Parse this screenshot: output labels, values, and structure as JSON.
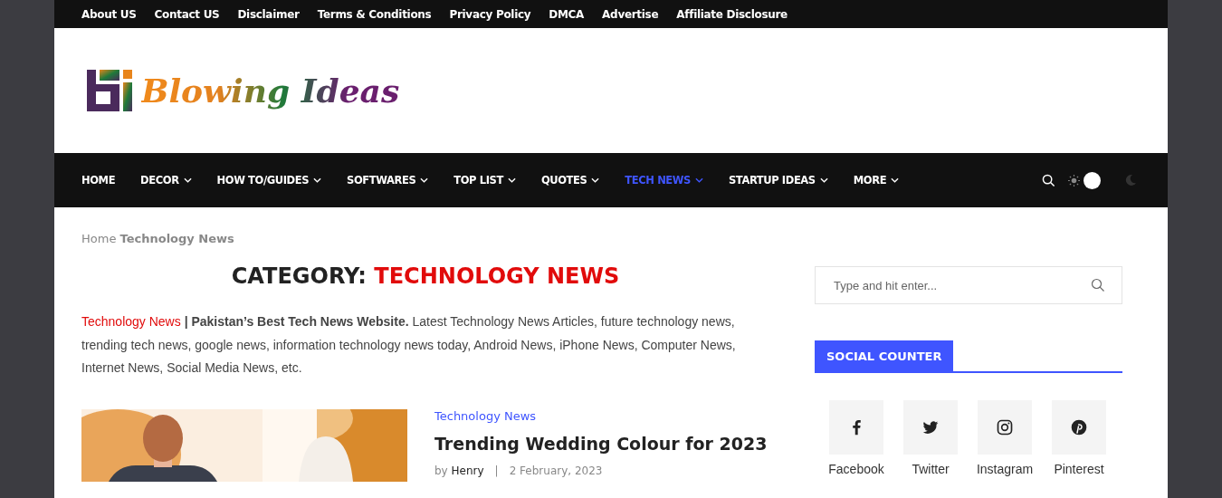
{
  "top_links": [
    "About US",
    "Contact US",
    "Disclaimer",
    "Terms & Conditions",
    "Privacy Policy",
    "DMCA",
    "Advertise",
    "Affiliate Disclosure"
  ],
  "logo": {
    "text": "Blowing Ideas"
  },
  "nav": [
    {
      "label": "HOME",
      "has_menu": false,
      "selected": false
    },
    {
      "label": "DECOR",
      "has_menu": true,
      "selected": false
    },
    {
      "label": "HOW TO/GUIDES",
      "has_menu": true,
      "selected": false
    },
    {
      "label": "SOFTWARES",
      "has_menu": true,
      "selected": false
    },
    {
      "label": "TOP LIST",
      "has_menu": true,
      "selected": false
    },
    {
      "label": "QUOTES",
      "has_menu": true,
      "selected": false
    },
    {
      "label": "TECH NEWS",
      "has_menu": true,
      "selected": true
    },
    {
      "label": "STARTUP IDEAS",
      "has_menu": true,
      "selected": false
    },
    {
      "label": "MORE",
      "has_menu": true,
      "selected": false
    }
  ],
  "dark_mode": false,
  "breadcrumb": {
    "home": "Home",
    "current": "Technology News"
  },
  "heading": {
    "prefix": "CATEGORY:",
    "name": "TECHNOLOGY NEWS"
  },
  "description": {
    "link": "Technology News",
    "text": "**| Pakistan’s Best Tech News Website.** Latest Technology News Articles, future technology news, trending tech news, google news, information technology news today, Android News, iPhone News, Computer News, Internet News, Social Media News, etc."
  },
  "article": {
    "category": "Technology News",
    "title": "Trending Wedding Colour for 2023",
    "by": "by",
    "author": "Henry",
    "separator": "|",
    "date": "2 February, 2023"
  },
  "search": {
    "placeholder": "Type and hit enter..."
  },
  "social_counter": {
    "title": "SOCIAL COUNTER",
    "items": [
      {
        "kind": "facebook",
        "label": "Facebook"
      },
      {
        "kind": "twitter",
        "label": "Twitter"
      },
      {
        "kind": "instagram",
        "label": "Instagram"
      },
      {
        "kind": "pinterest",
        "label": "Pinterest"
      }
    ]
  }
}
